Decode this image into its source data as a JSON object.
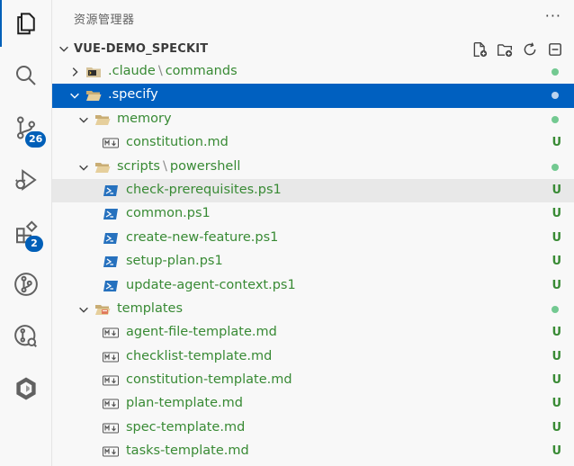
{
  "activity": {
    "scm_badge": "26",
    "extensions_badge": "2"
  },
  "explorer": {
    "title": "资源管理器",
    "more": "···",
    "section_title": "VUE-DEMO_SPECKIT"
  },
  "tree": {
    "claude_folder": ".claude",
    "claude_sub": "commands",
    "specify_folder": ".specify",
    "memory_folder": "memory",
    "constitution_file": "constitution.md",
    "scripts_folder": "scripts",
    "scripts_sub": "powershell",
    "ps_files": [
      "check-prerequisites.ps1",
      "common.ps1",
      "create-new-feature.ps1",
      "setup-plan.ps1",
      "update-agent-context.ps1"
    ],
    "templates_folder": "templates",
    "template_files": [
      "agent-file-template.md",
      "checklist-template.md",
      "constitution-template.md",
      "plan-template.md",
      "spec-template.md",
      "tasks-template.md"
    ],
    "untracked_status": "U"
  },
  "colors": {
    "accent": "#005fb8",
    "selection": "#0060c0",
    "untracked": "#388a34",
    "git_dot": "#73c991"
  }
}
